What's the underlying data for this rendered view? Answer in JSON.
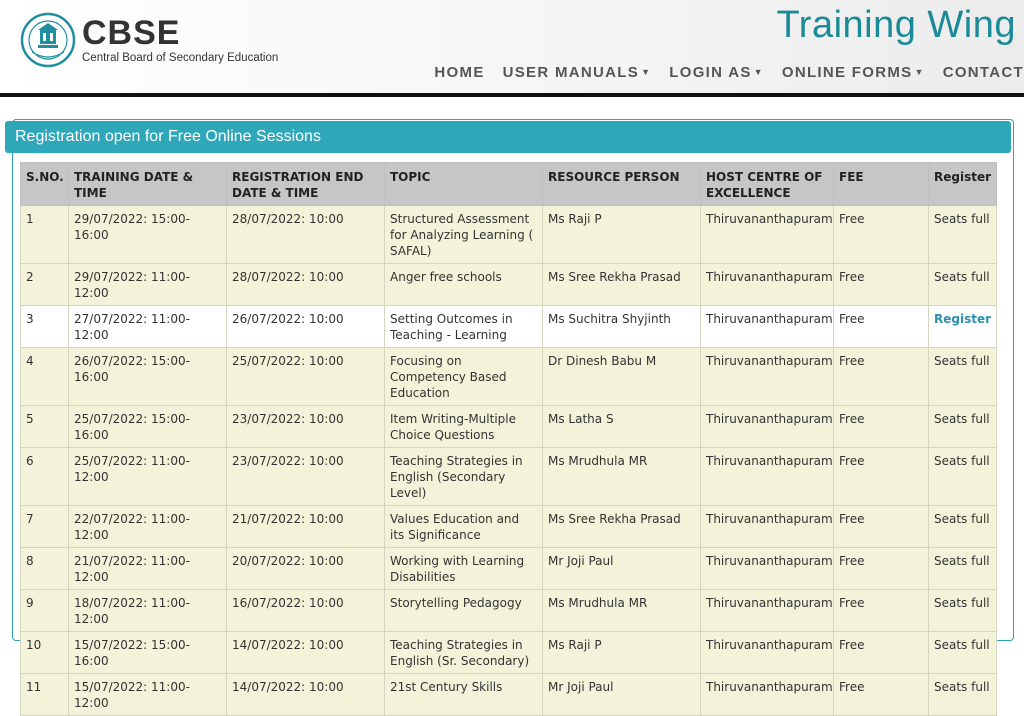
{
  "header": {
    "logo_name": "CBSE",
    "logo_subtitle": "Central Board of Secondary Education",
    "site_title": "Training Wing",
    "nav": [
      {
        "label": "HOME",
        "dropdown": false
      },
      {
        "label": "USER MANUALS",
        "dropdown": true
      },
      {
        "label": "LOGIN AS",
        "dropdown": true
      },
      {
        "label": "ONLINE FORMS",
        "dropdown": true
      },
      {
        "label": "CONTACT",
        "dropdown": false
      }
    ]
  },
  "panel": {
    "title": "Registration open for Free Online Sessions"
  },
  "table": {
    "headers": [
      "S.NO.",
      "TRAINING DATE & TIME",
      "REGISTRATION END DATE & TIME",
      "TOPIC",
      "RESOURCE PERSON",
      "HOST CENTRE OF EXCELLENCE",
      "FEE",
      "Register"
    ],
    "rows": [
      {
        "sno": "1",
        "date": "29/07/2022: 15:00-16:00",
        "reg_end": "28/07/2022: 10:00",
        "topic": "Structured Assessment for Analyzing Learning ( SAFAL)",
        "person": "Ms Raji P",
        "centre": "Thiruvananthapuram",
        "fee": "Free",
        "register": "Seats full",
        "open": false
      },
      {
        "sno": "2",
        "date": "29/07/2022: 11:00-12:00",
        "reg_end": "28/07/2022: 10:00",
        "topic": "Anger free schools",
        "person": "Ms Sree Rekha Prasad",
        "centre": "Thiruvananthapuram",
        "fee": "Free",
        "register": "Seats full",
        "open": false
      },
      {
        "sno": "3",
        "date": "27/07/2022: 11:00-12:00",
        "reg_end": "26/07/2022: 10:00",
        "topic": "Setting Outcomes in Teaching - Learning",
        "person": "Ms Suchitra Shyjinth",
        "centre": "Thiruvananthapuram",
        "fee": "Free",
        "register": "Register",
        "open": true
      },
      {
        "sno": "4",
        "date": "26/07/2022: 15:00-16:00",
        "reg_end": "25/07/2022: 10:00",
        "topic": "Focusing on Competency Based Education",
        "person": "Dr Dinesh Babu M",
        "centre": "Thiruvananthapuram",
        "fee": "Free",
        "register": "Seats full",
        "open": false
      },
      {
        "sno": "5",
        "date": "25/07/2022: 15:00-16:00",
        "reg_end": "23/07/2022: 10:00",
        "topic": "Item Writing-Multiple Choice Questions",
        "person": "Ms Latha S",
        "centre": "Thiruvananthapuram",
        "fee": "Free",
        "register": "Seats full",
        "open": false
      },
      {
        "sno": "6",
        "date": "25/07/2022: 11:00-12:00",
        "reg_end": "23/07/2022: 10:00",
        "topic": "Teaching Strategies in English (Secondary Level)",
        "person": "Ms Mrudhula MR",
        "centre": "Thiruvananthapuram",
        "fee": "Free",
        "register": "Seats full",
        "open": false
      },
      {
        "sno": "7",
        "date": "22/07/2022: 11:00-12:00",
        "reg_end": "21/07/2022: 10:00",
        "topic": "Values Education and its Significance",
        "person": "Ms Sree Rekha Prasad",
        "centre": "Thiruvananthapuram",
        "fee": "Free",
        "register": "Seats full",
        "open": false
      },
      {
        "sno": "8",
        "date": "21/07/2022: 11:00-12:00",
        "reg_end": "20/07/2022: 10:00",
        "topic": "Working with Learning Disabilities",
        "person": "Mr Joji Paul",
        "centre": "Thiruvananthapuram",
        "fee": "Free",
        "register": "Seats full",
        "open": false
      },
      {
        "sno": "9",
        "date": "18/07/2022: 11:00-12:00",
        "reg_end": "16/07/2022: 10:00",
        "topic": "Storytelling Pedagogy",
        "person": "Ms Mrudhula MR",
        "centre": "Thiruvananthapuram",
        "fee": "Free",
        "register": "Seats full",
        "open": false
      },
      {
        "sno": "10",
        "date": "15/07/2022: 15:00-16:00",
        "reg_end": "14/07/2022: 10:00",
        "topic": "Teaching Strategies in English (Sr. Secondary)",
        "person": "Ms Raji P",
        "centre": "Thiruvananthapuram",
        "fee": "Free",
        "register": "Seats full",
        "open": false
      },
      {
        "sno": "11",
        "date": "15/07/2022: 11:00-12:00",
        "reg_end": "14/07/2022: 10:00",
        "topic": "21st Century Skills",
        "person": "Mr Joji Paul",
        "centre": "Thiruvananthapuram",
        "fee": "Free",
        "register": "Seats full",
        "open": false
      }
    ]
  },
  "colors": {
    "accent": "#2ea7b8",
    "title": "#1a8a98",
    "row_bg": "#f3f3d9",
    "header_bg": "#c6c6c6",
    "link": "#2a8fb0"
  }
}
